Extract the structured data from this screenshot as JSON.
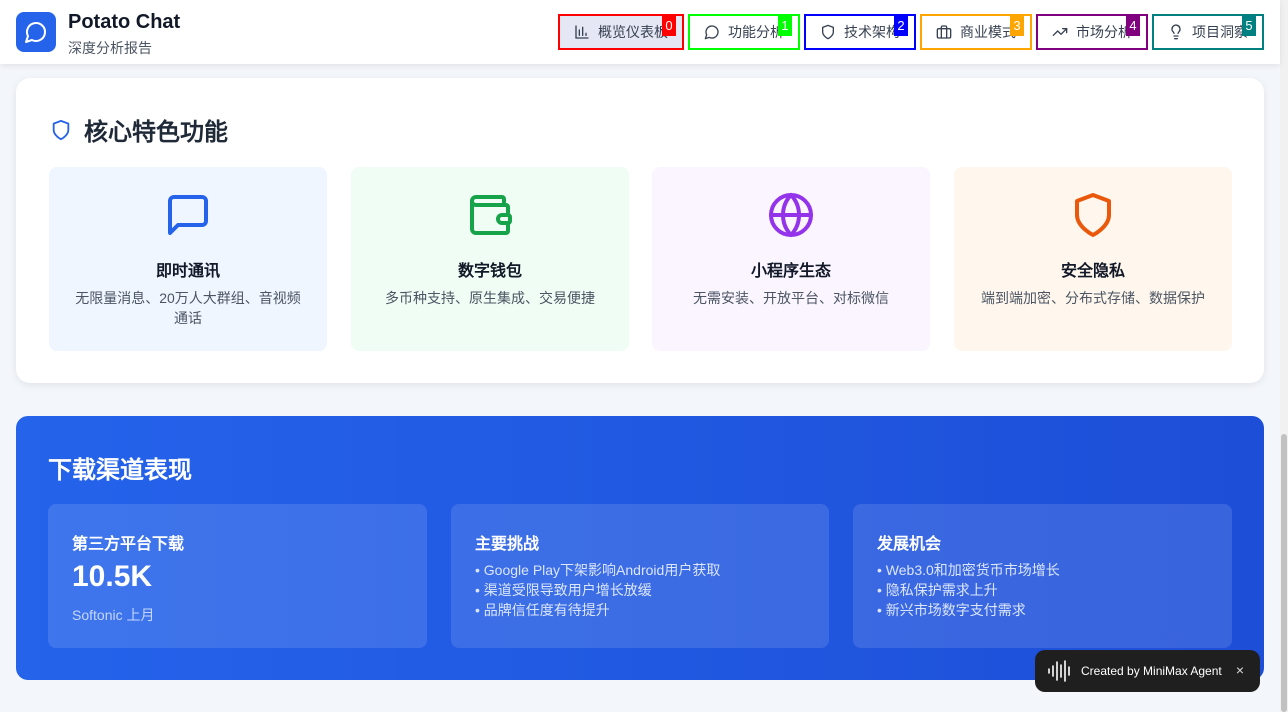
{
  "app": {
    "title": "Potato Chat",
    "subtitle": "深度分析报告",
    "logo_icon": "chat-bubble-icon",
    "accent": "#2563eb"
  },
  "nav": [
    {
      "label": "概览仪表板",
      "badge": "0",
      "icon": "bar-chart-icon",
      "border": "#ff0000",
      "badge_bg": "#ff0000",
      "active": true
    },
    {
      "label": "功能分析",
      "badge": "1",
      "icon": "message-circle-icon",
      "border": "#00ff00",
      "badge_bg": "#00ff00",
      "active": false
    },
    {
      "label": "技术架构",
      "badge": "2",
      "icon": "shield-icon",
      "border": "#0000ff",
      "badge_bg": "#0000ff",
      "active": false
    },
    {
      "label": "商业模式",
      "badge": "3",
      "icon": "briefcase-icon",
      "border": "#ffa500",
      "badge_bg": "#ffa500",
      "active": false
    },
    {
      "label": "市场分析",
      "badge": "4",
      "icon": "trending-up-icon",
      "border": "#800080",
      "badge_bg": "#800080",
      "active": false
    },
    {
      "label": "项目洞察",
      "badge": "5",
      "icon": "lightbulb-icon",
      "border": "#008080",
      "badge_bg": "#008080",
      "active": false
    }
  ],
  "features": {
    "title": "核心特色功能",
    "icon": "shield-icon",
    "items": [
      {
        "title": "即时通讯",
        "desc": "无限量消息、20万人大群组、音视频通话",
        "icon": "message-square-icon",
        "color": "#2563eb",
        "bg": "#eff6ff"
      },
      {
        "title": "数字钱包",
        "desc": "多币种支持、原生集成、交易便捷",
        "icon": "wallet-icon",
        "color": "#16a34a",
        "bg": "#f0fdf4"
      },
      {
        "title": "小程序生态",
        "desc": "无需安装、开放平台、对标微信",
        "icon": "globe-icon",
        "color": "#9333ea",
        "bg": "#faf5ff"
      },
      {
        "title": "安全隐私",
        "desc": "端到端加密、分布式存储、数据保护",
        "icon": "shield-icon",
        "color": "#ea580c",
        "bg": "#fff7ed"
      }
    ]
  },
  "downloads": {
    "title": "下载渠道表现",
    "stat": {
      "title": "第三方平台下载",
      "value": "10.5K",
      "note": "Softonic 上月"
    },
    "challenges": {
      "title": "主要挑战",
      "items": [
        "• Google Play下架影响Android用户获取",
        "• 渠道受限导致用户增长放缓",
        "• 品牌信任度有待提升"
      ]
    },
    "opportunities": {
      "title": "发展机会",
      "items": [
        "• Web3.0和加密货币市场增长",
        "• 隐私保护需求上升",
        "• 新兴市场数字支付需求"
      ]
    }
  },
  "toast": {
    "text": "Created by MiniMax Agent",
    "close": "×",
    "icon": "sound-wave-icon"
  }
}
